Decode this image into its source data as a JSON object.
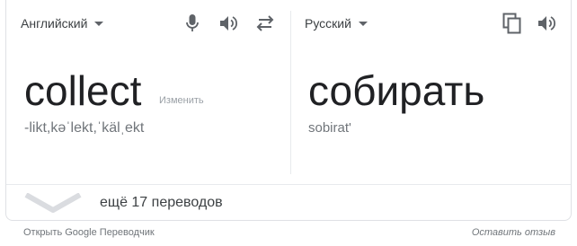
{
  "source": {
    "language": "Английский",
    "word": "collect",
    "edit_label": "Изменить",
    "transcription": "-likt,kəˈlekt,ˈkälˌekt"
  },
  "target": {
    "language": "Русский",
    "word": "собирать",
    "transliteration": "sobirat'"
  },
  "more_translations": "ещё 17 переводов",
  "footer": {
    "open_translator": "Открыть Google Переводчик",
    "feedback": "Оставить отзыв"
  },
  "icons": {
    "mic": "microphone-icon",
    "speaker": "speaker-icon",
    "swap": "swap-languages-icon",
    "copy": "copy-icon",
    "expand": "chevron-down-icon"
  }
}
